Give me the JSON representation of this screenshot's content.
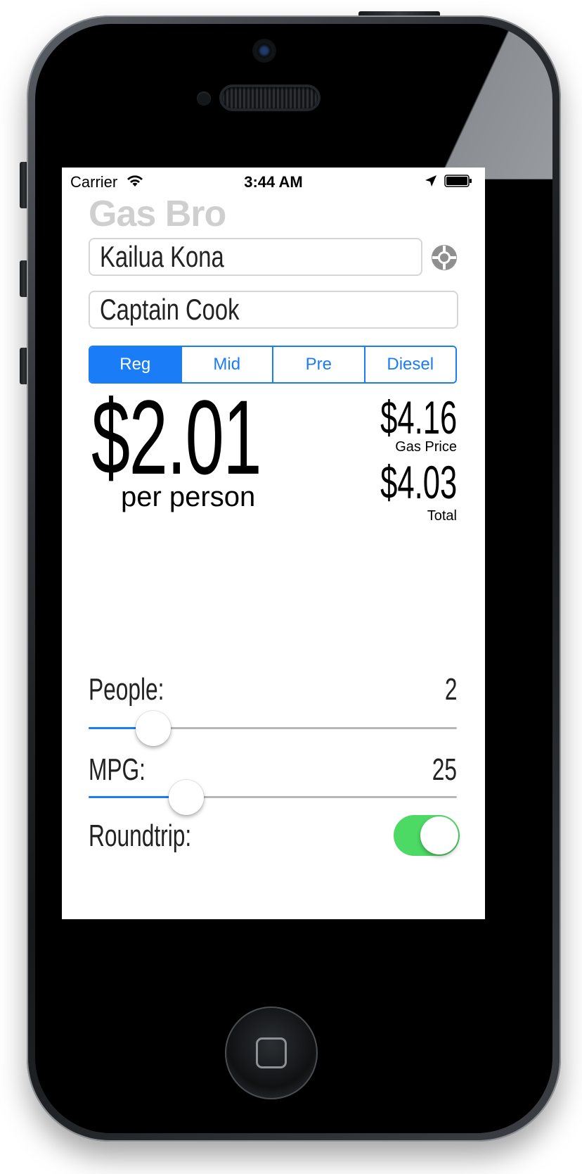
{
  "status_bar": {
    "carrier": "Carrier",
    "time": "3:44 AM",
    "wifi_icon": "wifi-icon",
    "location_icon": "location-arrow-icon",
    "battery_icon": "battery-full-icon"
  },
  "app": {
    "title": "Gas Bro"
  },
  "route": {
    "from_value": "Kailua Kona",
    "to_value": "Captain Cook",
    "locate_icon": "crosshair-locate-icon"
  },
  "fuel_types": {
    "selected": "Reg",
    "options": [
      "Reg",
      "Mid",
      "Pre",
      "Diesel"
    ]
  },
  "results": {
    "per_person_amount": "$2.01",
    "per_person_label": "per person",
    "gas_price_amount": "$4.16",
    "gas_price_label": "Gas Price",
    "total_amount": "$4.03",
    "total_label": "Total"
  },
  "people": {
    "label": "People:",
    "value": "2",
    "slider_fraction": 0.175
  },
  "mpg": {
    "label": "MPG:",
    "value": "25",
    "slider_fraction": 0.265
  },
  "roundtrip": {
    "label": "Roundtrip:",
    "enabled": true
  },
  "colors": {
    "accent": "#1a7cf7",
    "toggle_on": "#4cd964",
    "title_gray": "#cfcfcf"
  }
}
